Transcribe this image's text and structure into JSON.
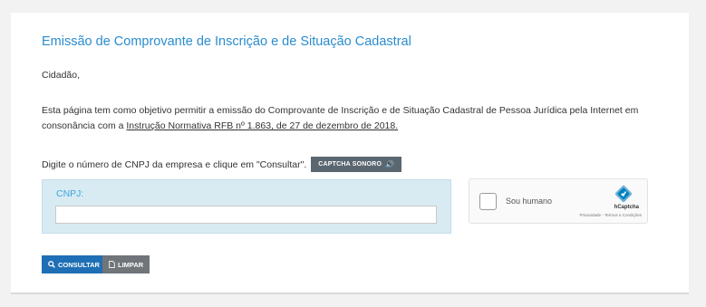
{
  "page": {
    "title": "Emissão de Comprovante de Inscrição e de Situação Cadastral",
    "greeting": "Cidadão,",
    "description_text": "Esta página tem como objetivo permitir a emissão do Comprovante de Inscrição e de Situação Cadastral de Pessoa Jurídica pela Internet em consonância com a ",
    "description_link": "Instrução Normativa RFB nº 1.863, de 27 de dezembro de 2018.",
    "prompt": "Digite o número de CNPJ da empresa e clique em \"Consultar\".",
    "audio_captcha_label": "CAPTCHA SONORO",
    "cnpj_label": "CNPJ:",
    "cnpj_value": ""
  },
  "captcha": {
    "checkbox_label": "Sou humano",
    "brand": "hCaptcha",
    "links": "Privacidade - Termos e Condições"
  },
  "actions": {
    "consultar_label": "CONSULTAR",
    "limpar_label": "LIMPAR"
  },
  "icons": {
    "audio": "speaker-icon",
    "search": "search-icon",
    "clear": "document-icon",
    "captcha_logo": "hcaptcha-logo-icon"
  },
  "colors": {
    "title": "#2a8ccf",
    "panel_bg": "#d8ebf3",
    "primary_button": "#1e6fb5",
    "secondary_button": "#6f7579",
    "audio_button": "#5b6770"
  }
}
